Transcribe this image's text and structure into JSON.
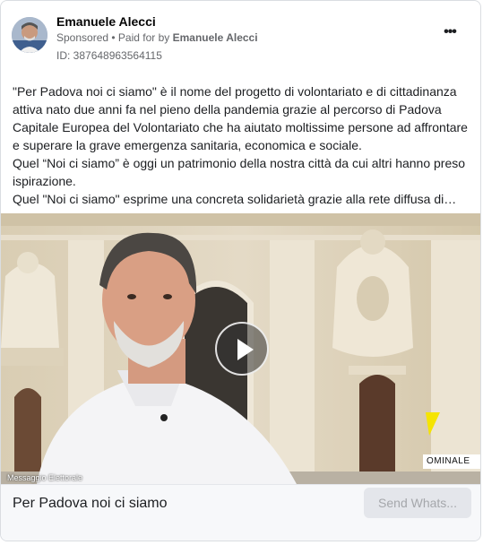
{
  "post": {
    "author": "Emanuele Alecci",
    "sponsored": "Sponsored",
    "separator": " • ",
    "paid_for_prefix": "Paid for by ",
    "paid_for_name": "Emanuele Alecci",
    "library_id": "ID: 387648963564115",
    "more_icon": "more-horizontal-icon"
  },
  "body": {
    "paragraphs": [
      "\"Per Padova noi ci siamo\" è il nome del progetto di volontariato e di cittadinanza attiva nato due anni fa nel pieno della pandemia grazie al percorso di Padova Capitale Europea del Volontariato che ha aiutato moltissime persone ad affrontare e superare la grave emergenza sanitaria, economica e sociale.",
      "Quel “Noi ci siamo” è oggi un patrimonio della nostra città da cui altri hanno preso ispirazione.",
      "Quel \"Noi ci siamo\" esprime una concreta solidarietà grazie alla rete diffusa di…"
    ]
  },
  "media": {
    "watermark": "Messaggio Elettorale",
    "lower_third": "OMINALE",
    "play_icon": "play-icon"
  },
  "footer": {
    "title": "Per Padova noi ci siamo",
    "cta_label": "Send Whats..."
  },
  "colors": {
    "secondary_text": "#65676b",
    "button_bg": "#e4e6eb",
    "button_text": "#a5a7ab",
    "footer_bg": "#f7f8fa"
  }
}
